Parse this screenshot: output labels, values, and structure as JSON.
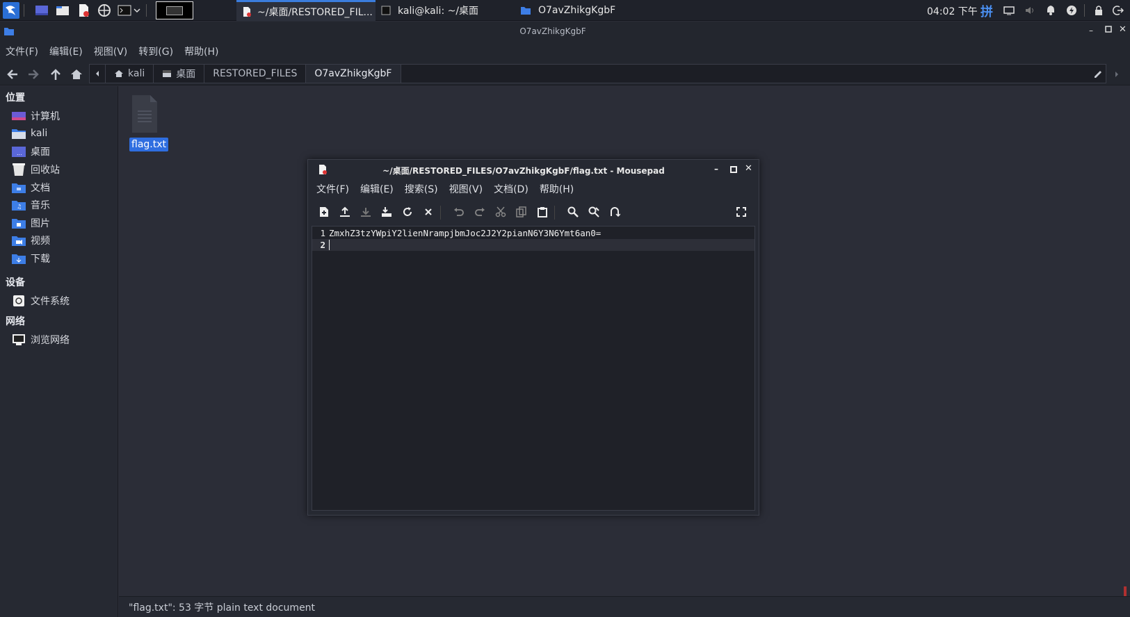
{
  "taskbar": {
    "tasks": [
      {
        "label": "~/桌面/RESTORED_FIL..."
      },
      {
        "label": "kali@kali: ~/桌面"
      },
      {
        "label": "O7avZhikgKgbF"
      }
    ],
    "clock": "04:02 下午",
    "input_method": "拼"
  },
  "file_manager": {
    "title": "O7avZhikgKgbF",
    "menu": [
      "文件(F)",
      "编辑(E)",
      "视图(V)",
      "转到(G)",
      "帮助(H)"
    ],
    "path": [
      "kali",
      "桌面",
      "RESTORED_FILES",
      "O7avZhikgKgbF"
    ],
    "sidebar": {
      "places_header": "位置",
      "places": [
        "计算机",
        "kali",
        "桌面",
        "回收站",
        "文档",
        "音乐",
        "图片",
        "视频",
        "下载"
      ],
      "devices_header": "设备",
      "devices": [
        "文件系统"
      ],
      "network_header": "网络",
      "network": [
        "浏览网络"
      ]
    },
    "file": {
      "name": "flag.txt"
    },
    "status": "\"flag.txt\": 53 字节 plain text document"
  },
  "mousepad": {
    "title": "~/桌面/RESTORED_FILES/O7avZhikgKgbF/flag.txt - Mousepad",
    "menu": [
      "文件(F)",
      "编辑(E)",
      "搜索(S)",
      "视图(V)",
      "文档(D)",
      "帮助(H)"
    ],
    "lines": [
      {
        "num": "1",
        "text": "ZmxhZ3tzYWpiY2lienNrampjbmJoc2J2Y2pianN6Y3N6Ymt6an0="
      },
      {
        "num": "2",
        "text": ""
      }
    ]
  },
  "colors": {
    "accent": "#3b7ddd",
    "folder": "#3d7ee6",
    "background": "#2b2d37"
  }
}
